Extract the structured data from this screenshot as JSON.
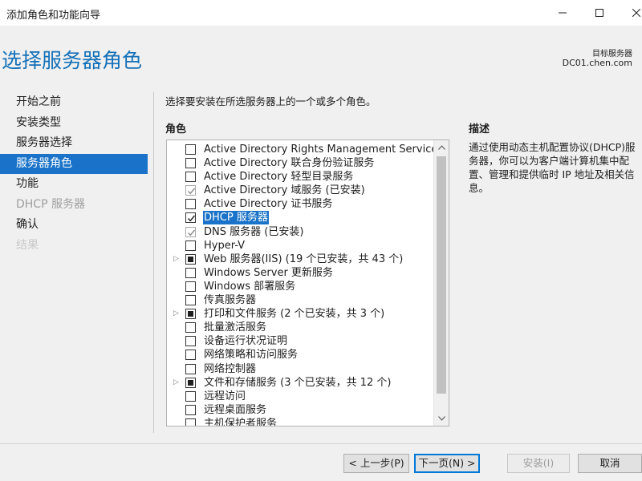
{
  "window": {
    "title": "添加角色和功能向导"
  },
  "header": {
    "page_title": "选择服务器角色",
    "target_label": "目标服务器",
    "target_server": "DC01.chen.com"
  },
  "nav": {
    "items": [
      {
        "label": "开始之前",
        "state": "normal"
      },
      {
        "label": "安装类型",
        "state": "normal"
      },
      {
        "label": "服务器选择",
        "state": "normal"
      },
      {
        "label": "服务器角色",
        "state": "active"
      },
      {
        "label": "功能",
        "state": "normal"
      },
      {
        "label": "DHCP 服务器",
        "state": "disabled"
      },
      {
        "label": "确认",
        "state": "normal"
      },
      {
        "label": "结果",
        "state": "faint"
      }
    ]
  },
  "main": {
    "intro": "选择要安装在所选服务器上的一个或多个角色。",
    "roles_heading": "角色",
    "roles": [
      {
        "label": "Active Directory Rights Management Services",
        "state": "unchecked",
        "expandable": false
      },
      {
        "label": "Active Directory 联合身份验证服务",
        "state": "unchecked",
        "expandable": false
      },
      {
        "label": "Active Directory 轻型目录服务",
        "state": "unchecked",
        "expandable": false
      },
      {
        "label": "Active Directory 域服务 (已安装)",
        "state": "checked-disabled",
        "expandable": false
      },
      {
        "label": "Active Directory 证书服务",
        "state": "unchecked",
        "expandable": false
      },
      {
        "label": "DHCP 服务器",
        "state": "checked",
        "expandable": false,
        "selected": true
      },
      {
        "label": "DNS 服务器 (已安装)",
        "state": "checked-disabled",
        "expandable": false
      },
      {
        "label": "Hyper-V",
        "state": "unchecked",
        "expandable": false
      },
      {
        "label": "Web 服务器(IIS) (19 个已安装，共 43 个)",
        "state": "partial",
        "expandable": true
      },
      {
        "label": "Windows Server 更新服务",
        "state": "unchecked",
        "expandable": false
      },
      {
        "label": "Windows 部署服务",
        "state": "unchecked",
        "expandable": false
      },
      {
        "label": "传真服务器",
        "state": "unchecked",
        "expandable": false
      },
      {
        "label": "打印和文件服务 (2 个已安装，共 3 个)",
        "state": "partial",
        "expandable": true
      },
      {
        "label": "批量激活服务",
        "state": "unchecked",
        "expandable": false
      },
      {
        "label": "设备运行状况证明",
        "state": "unchecked",
        "expandable": false
      },
      {
        "label": "网络策略和访问服务",
        "state": "unchecked",
        "expandable": false
      },
      {
        "label": "网络控制器",
        "state": "unchecked",
        "expandable": false
      },
      {
        "label": "文件和存储服务 (3 个已安装，共 12 个)",
        "state": "partial",
        "expandable": true
      },
      {
        "label": "远程访问",
        "state": "unchecked",
        "expandable": false
      },
      {
        "label": "远程桌面服务",
        "state": "unchecked",
        "expandable": false
      },
      {
        "label": "主机保护者服务",
        "state": "unchecked",
        "expandable": false
      }
    ],
    "description_heading": "描述",
    "description": "通过使用动态主机配置协议(DHCP)服务器，你可以为客户端计算机集中配置、管理和提供临时 IP 地址及相关信息。"
  },
  "footer": {
    "prev_label": "< 上一步(P)",
    "next_label": "下一页(N) >",
    "install_label": "安装(I)",
    "cancel_label": "取消"
  },
  "colors": {
    "accent": "#1a73c8",
    "title_blue": "#1470b8"
  }
}
